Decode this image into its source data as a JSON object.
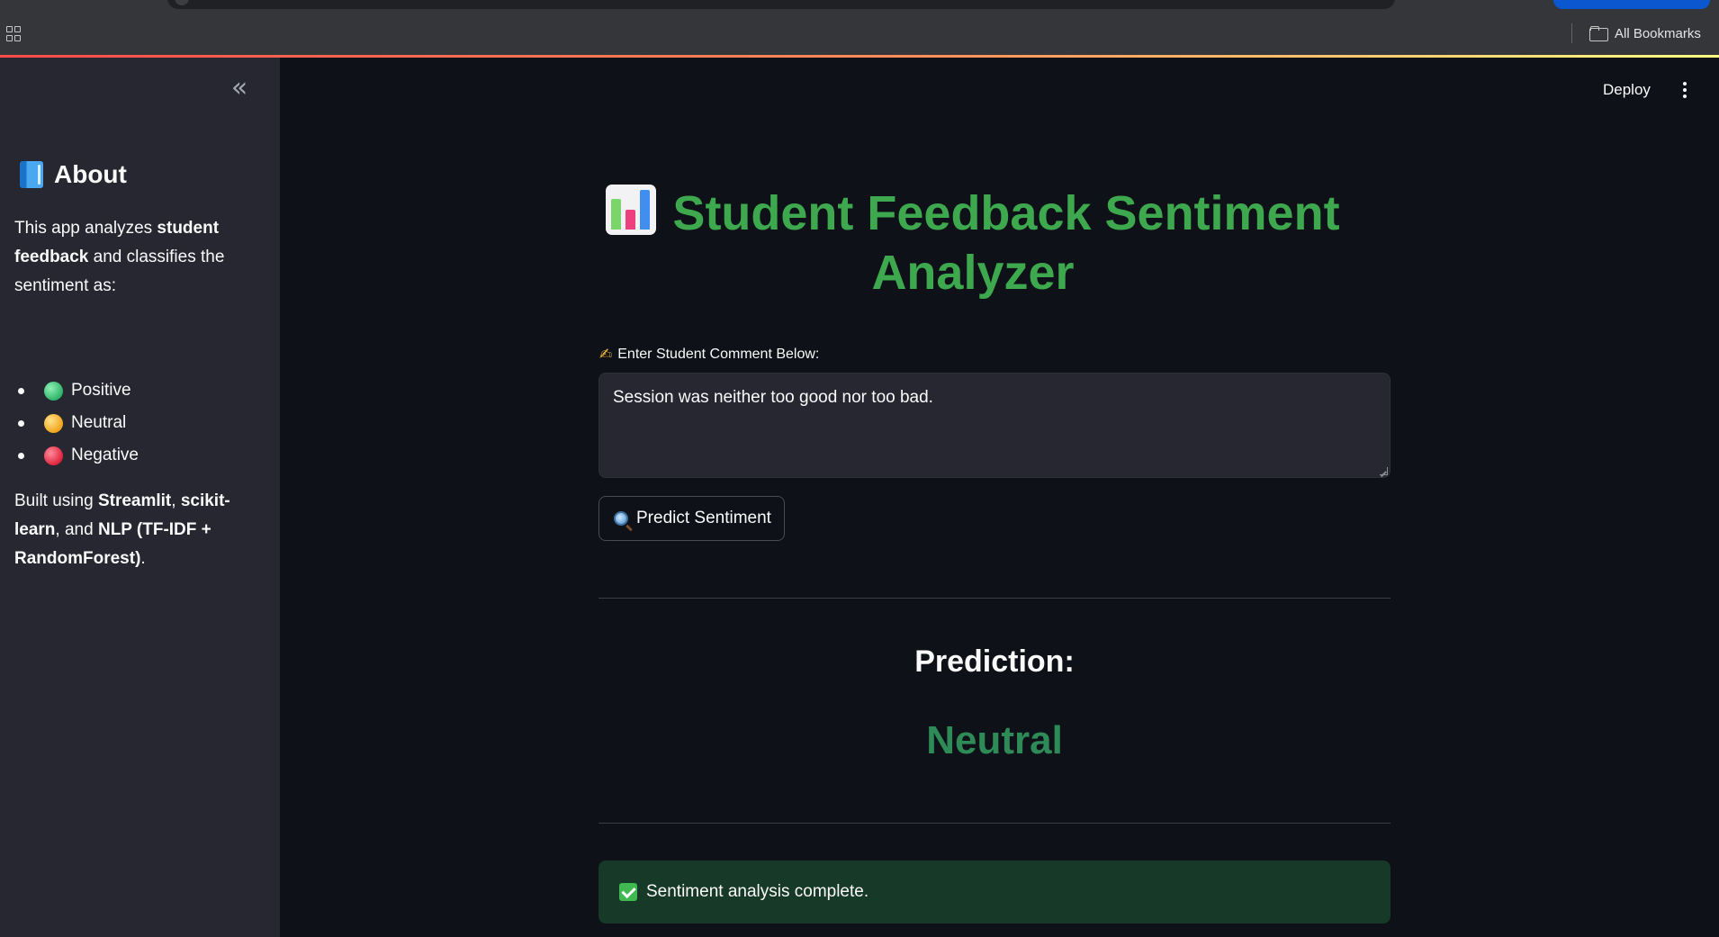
{
  "browser": {
    "bookmarks_label": "All Bookmarks"
  },
  "sidebar": {
    "about_title": "About",
    "about_intro_1": "This app analyzes ",
    "about_intro_bold_1": "student feedback",
    "about_intro_2": " and classifies the sentiment as:",
    "sentiments": [
      {
        "label": "Positive",
        "color": "#2fb46a"
      },
      {
        "label": "Neutral",
        "color": "#f0a51c"
      },
      {
        "label": "Negative",
        "color": "#e0243e"
      }
    ],
    "built_1": "Built using ",
    "built_bold_1": "Streamlit",
    "built_2": ", ",
    "built_bold_2": "scikit-learn",
    "built_3": ", and ",
    "built_bold_3": "NLP (TF-IDF + RandomForest)",
    "built_4": "."
  },
  "header": {
    "deploy_label": "Deploy"
  },
  "main": {
    "title": "Student Feedback Sentiment Analyzer",
    "title_color": "#3ea84e",
    "input_label": "Enter Student Comment Below:",
    "comment_value": "Session was neither too good nor too bad.",
    "predict_button": "Predict Sentiment",
    "prediction_label": "Prediction:",
    "prediction_value": "Neutral",
    "prediction_color": "#2e8b57",
    "success_message": "Sentiment analysis complete."
  }
}
